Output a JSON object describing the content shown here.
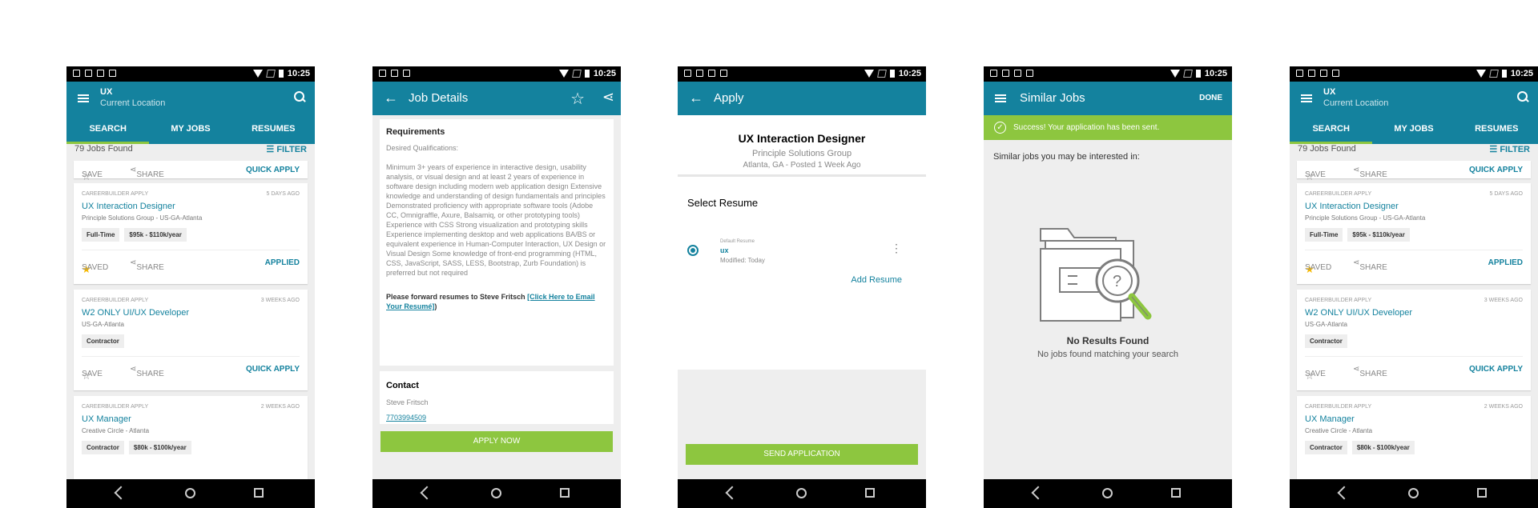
{
  "status": {
    "time": "10:25"
  },
  "list": {
    "title": "UX",
    "subtitle": "Current Location",
    "tabs": [
      "SEARCH",
      "MY JOBS",
      "RESUMES"
    ],
    "count": "79 Jobs Found",
    "filter": "FILTER",
    "save": "SAVE",
    "saved": "SAVED",
    "share": "SHARE",
    "quick_apply": "QUICK APPLY",
    "applied": "APPLIED",
    "jobs": [
      {
        "source": "CAREERBUILDER APPLY",
        "date": "5 DAYS AGO",
        "title": "UX Interaction Designer",
        "company": "Principle Solutions Group - US-GA-Atlanta",
        "chips": [
          "Full-Time",
          "$95k - $110k/year"
        ]
      },
      {
        "source": "CAREERBUILDER APPLY",
        "date": "3 WEEKS AGO",
        "title": "W2 ONLY UI/UX Developer",
        "company": "US-GA-Atlanta",
        "chips": [
          "Contractor"
        ]
      },
      {
        "source": "CAREERBUILDER APPLY",
        "date": "2 WEEKS AGO",
        "title": "UX Manager",
        "company": "Creative Circle - Atlanta",
        "chips": [
          "Contractor",
          "$80k - $100k/year"
        ]
      }
    ]
  },
  "details": {
    "title": "Job Details",
    "req_h": "Requirements",
    "desired": "Desired Qualifications:",
    "body": "Minimum 3+ years of experience in interactive design, usability analysis, or visual design and at least 2 years of experience in software design including modern web application design Extensive knowledge and understanding of design fundamentals and principles Demonstrated proficiency with appropriate software tools (Adobe CC, Omnigraffle, Axure, Balsamiq, or other prototyping tools) Experience with CSS Strong visualization and prototyping skills Experience implementing desktop and web applications BA/BS or equivalent experience in Human-Computer Interaction, UX Design or Visual Design Some knowledge of front-end programming (HTML, CSS, JavaScript, SASS, LESS, Bootstrap, Zurb Foundation) is preferred but not required",
    "forward": "Please forward resumes to Steve Fritsch ",
    "link": "[Click Here to Email Your Resumé]",
    "contact_h": "Contact",
    "contact_name": "Steve Fritsch",
    "phone": "7703994509",
    "apply": "APPLY NOW"
  },
  "apply": {
    "title": "Apply",
    "job": "UX Interaction Designer",
    "company": "Principle Solutions Group",
    "loc": "Atlanta, GA - Posted 1 Week Ago",
    "select": "Select Resume",
    "default": "Default Resume",
    "name": "ux",
    "modified": "Modified: Today",
    "add": "Add Resume",
    "send": "SEND APPLICATION"
  },
  "similar": {
    "title": "Similar Jobs",
    "done": "DONE",
    "success": "Success! Your application has been sent.",
    "intro": "Similar jobs you may be interested in:",
    "nores": "No Results Found",
    "nores_sub": "No jobs found matching your search"
  }
}
